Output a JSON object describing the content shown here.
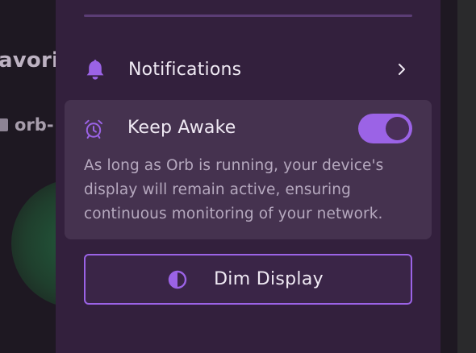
{
  "background": {
    "title_partial": "avori",
    "row_partial": "orb-"
  },
  "panel": {
    "notifications": {
      "label": "Notifications",
      "icon": "bell-icon"
    },
    "keep_awake": {
      "label": "Keep Awake",
      "icon": "alarm-clock-icon",
      "enabled": true,
      "description": "As long as Orb is running, your device's display will remain active, ensuring continuous monitoring of your network."
    },
    "dim_display": {
      "label": "Dim Display",
      "icon": "contrast-icon"
    }
  },
  "colors": {
    "panel_bg": "#33203d",
    "card_bg": "#45324f",
    "accent": "#9b63e6",
    "text_primary": "#efe9f3",
    "text_secondary": "#b6a9bf"
  }
}
